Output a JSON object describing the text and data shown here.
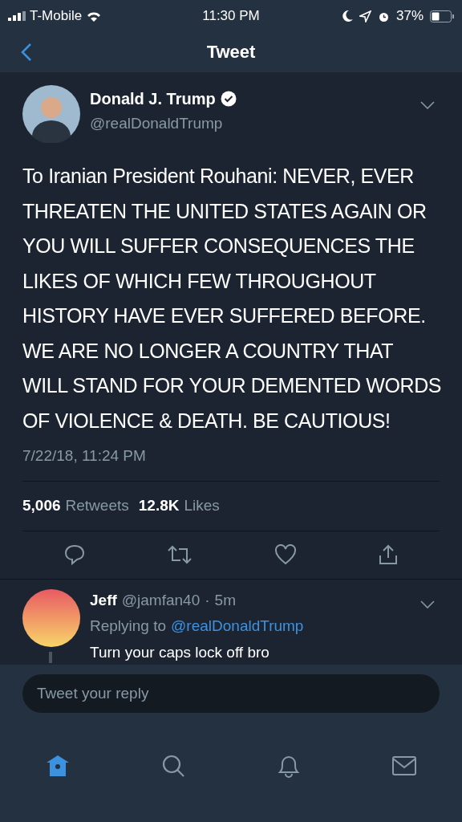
{
  "status_bar": {
    "carrier": "T-Mobile",
    "time": "11:30 PM",
    "battery": "37%"
  },
  "nav": {
    "title": "Tweet"
  },
  "tweet": {
    "name": "Donald J. Trump",
    "verified": true,
    "handle": "@realDonaldTrump",
    "text": "To Iranian President Rouhani: NEVER, EVER THREATEN THE UNITED STATES AGAIN OR YOU WILL SUFFER CONSEQUENCES THE LIKES OF WHICH FEW THROUGHOUT HISTORY HAVE EVER SUFFERED BEFORE. WE ARE NO LONGER A COUNTRY THAT WILL STAND FOR YOUR DEMENTED WORDS OF VIOLENCE & DEATH. BE CAUTIOUS!",
    "timestamp": "7/22/18, 11:24 PM",
    "stats": [
      {
        "count": "5,006",
        "label": "Retweets"
      },
      {
        "count": "12.8K",
        "label": "Likes"
      }
    ]
  },
  "reply": {
    "name": "Jeff",
    "handle": "@jamfan40",
    "separator": "·",
    "age": "5m",
    "replying_label": "Replying to",
    "replying_to": "@realDonaldTrump",
    "text": "Turn your caps lock off bro"
  },
  "composer": {
    "placeholder": "Tweet your reply"
  },
  "tab_bar": [
    {
      "kind": "home",
      "selected": true
    },
    {
      "kind": "search",
      "selected": false
    },
    {
      "kind": "notifications",
      "selected": false
    },
    {
      "kind": "messages",
      "selected": false
    }
  ]
}
